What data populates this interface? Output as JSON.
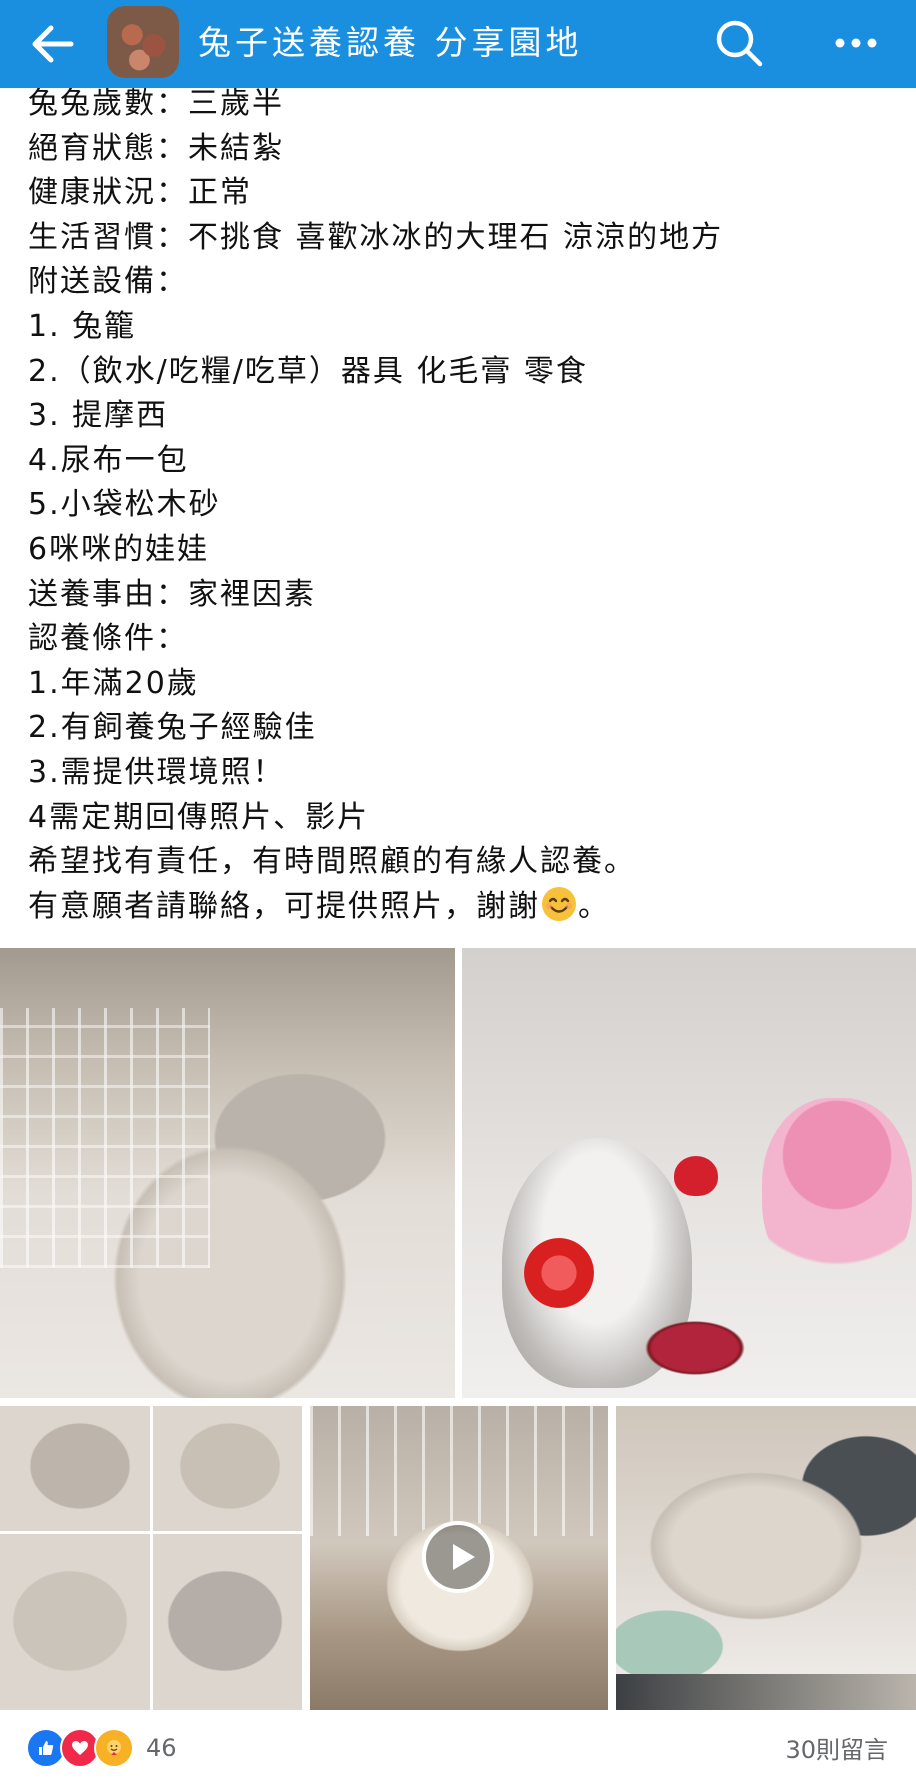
{
  "header": {
    "title": "兔子送養認養 分享園地",
    "back_icon": "back-arrow-icon",
    "search_icon": "search-icon",
    "more_icon": "more-dots-icon",
    "bar_color": "#1a8fe0"
  },
  "post": {
    "lines": [
      "兔兔歲數：三歲半",
      "絕育狀態：未結紮",
      "健康狀況：正常",
      "生活習慣：不挑食 喜歡冰冰的大理石 涼涼的地方",
      "附送設備：",
      "1. 兔籠",
      "2.（飲水/吃糧/吃草）器具 化毛膏 零食",
      "3. 提摩西",
      "4.尿布一包",
      "5.小袋松木砂",
      "6咪咪的娃娃",
      "送養事由：家裡因素",
      "認養條件：",
      "1.年滿20歲",
      "2.有飼養兔子經驗佳",
      "3.需提供環境照！",
      "4需定期回傳照片、影片",
      "希望找有責任，有時間照顧的有緣人認養。",
      "有意願者請聯絡，可提供照片，謝謝",
      "。"
    ],
    "emoji": "smiling-face-emoji"
  },
  "media": {
    "video_icon": "play-icon"
  },
  "footer": {
    "reaction_count": "46",
    "reactions": [
      "like",
      "love",
      "care"
    ],
    "comments": "30則留言"
  }
}
